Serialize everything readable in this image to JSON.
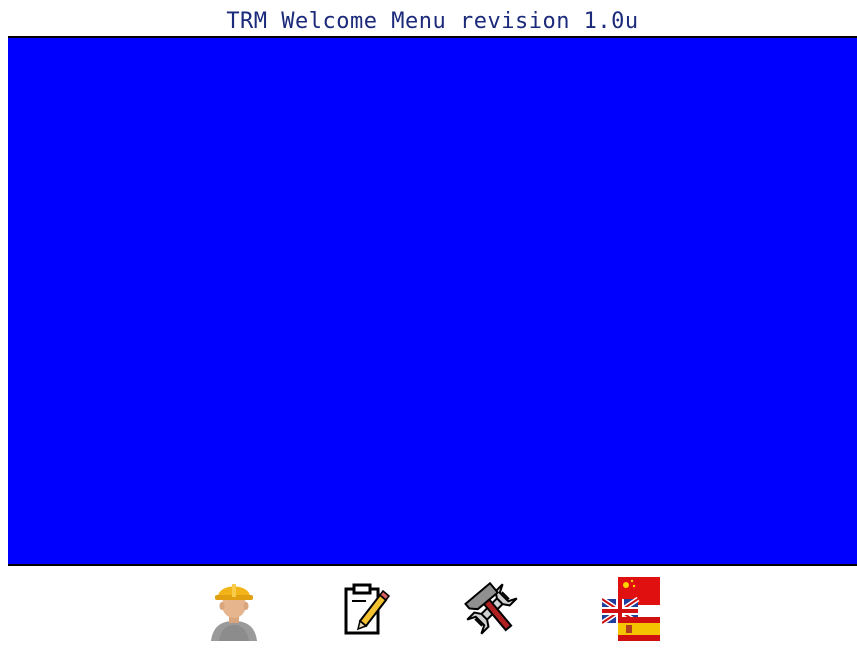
{
  "title": "TRM Welcome Menu revision 1.0u",
  "colors": {
    "background": "#0000ff",
    "title_text": "#1b2a7a",
    "bar_background": "#ffffff"
  },
  "toolbar": {
    "buttons": [
      {
        "id": "operator",
        "icon": "worker-hardhat-icon"
      },
      {
        "id": "edit",
        "icon": "clipboard-pencil-icon"
      },
      {
        "id": "tools",
        "icon": "hammer-wrench-icon"
      },
      {
        "id": "language",
        "icon": "flags-language-icon"
      }
    ]
  }
}
